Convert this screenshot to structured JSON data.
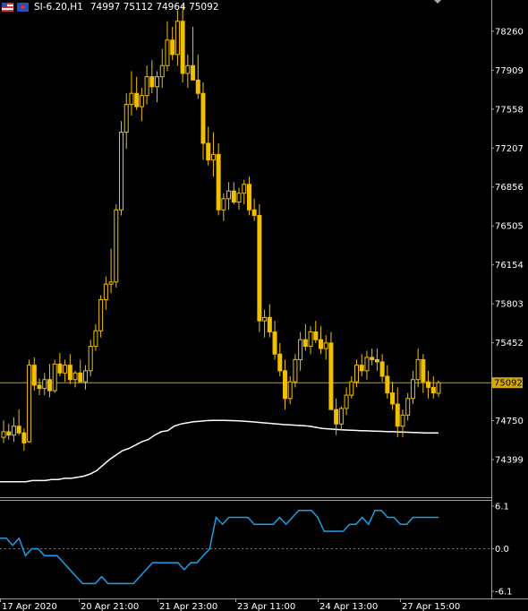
{
  "header": {
    "symbol": "SI-6.20,H1",
    "ohlc": "74997 75112 74964 75092"
  },
  "colors": {
    "background": "#000000",
    "axis": "#a0a0a0",
    "candle": "#f0c000",
    "ma": "#ffffff",
    "indicator": "#1e9fe8",
    "price_line": "#c8a200",
    "price_label_bg": "#d4a800"
  },
  "price_axis": {
    "labels": [
      "78260",
      "77909",
      "77558",
      "77207",
      "76856",
      "76505",
      "76154",
      "75803",
      "75452",
      "74750",
      "74399"
    ],
    "current_price": "75092"
  },
  "indicator_axis": {
    "labels": [
      "6.1",
      "0.0",
      "-6.1"
    ]
  },
  "time_axis": {
    "labels": [
      "17 Apr 2020",
      "20 Apr 21:00",
      "21 Apr 23:00",
      "23 Apr 11:00",
      "24 Apr 13:00",
      "27 Apr 15:00"
    ]
  },
  "chart_data": {
    "type": "candlestick",
    "symbol": "SI-6.20",
    "timeframe": "H1",
    "price_range": [
      74060,
      78380
    ],
    "indicator_range": [
      -6.1,
      6.1
    ],
    "candles": [
      [
        74600,
        74750,
        74550,
        74650
      ],
      [
        74650,
        74720,
        74580,
        74620
      ],
      [
        74620,
        74780,
        74560,
        74700
      ],
      [
        74700,
        74850,
        74620,
        74640
      ],
      [
        74640,
        74680,
        74480,
        74550
      ],
      [
        74560,
        75300,
        74550,
        75250
      ],
      [
        75250,
        75320,
        75020,
        75070
      ],
      [
        75070,
        75130,
        74980,
        75040
      ],
      [
        75040,
        75180,
        74980,
        75120
      ],
      [
        75120,
        75260,
        74960,
        75020
      ],
      [
        75020,
        75300,
        75000,
        75260
      ],
      [
        75260,
        75360,
        75150,
        75180
      ],
      [
        75180,
        75300,
        75100,
        75250
      ],
      [
        75250,
        75350,
        75080,
        75120
      ],
      [
        75120,
        75200,
        75050,
        75180
      ],
      [
        75180,
        75300,
        75100,
        75100
      ],
      [
        75100,
        75250,
        75030,
        75200
      ],
      [
        75200,
        75480,
        75150,
        75420
      ],
      [
        75420,
        75620,
        75380,
        75560
      ],
      [
        75560,
        75880,
        75500,
        75840
      ],
      [
        75840,
        76050,
        75750,
        75980
      ],
      [
        75980,
        76300,
        75900,
        76000
      ],
      [
        76000,
        76700,
        75950,
        76650
      ],
      [
        76650,
        77450,
        76600,
        77350
      ],
      [
        77350,
        77700,
        77200,
        77600
      ],
      [
        77600,
        77900,
        77500,
        77700
      ],
      [
        77700,
        77850,
        77550,
        77580
      ],
      [
        77580,
        77750,
        77450,
        77680
      ],
      [
        77680,
        77950,
        77600,
        77850
      ],
      [
        77850,
        78000,
        77700,
        77760
      ],
      [
        77760,
        77900,
        77620,
        77850
      ],
      [
        77850,
        78100,
        77750,
        77950
      ],
      [
        77950,
        78350,
        77900,
        78180
      ],
      [
        78180,
        78300,
        78000,
        78050
      ],
      [
        78050,
        78450,
        77950,
        78350
      ],
      [
        78350,
        78500,
        77800,
        77880
      ],
      [
        77880,
        78050,
        77750,
        77950
      ],
      [
        77950,
        78300,
        77850,
        77820
      ],
      [
        77820,
        78050,
        77650,
        77700
      ],
      [
        77700,
        77800,
        77100,
        77250
      ],
      [
        77250,
        77400,
        77050,
        77100
      ],
      [
        77100,
        77350,
        76950,
        77150
      ],
      [
        77150,
        77250,
        76600,
        76650
      ],
      [
        76650,
        76800,
        76550,
        76750
      ],
      [
        76750,
        76900,
        76650,
        76820
      ],
      [
        76820,
        76900,
        76700,
        76720
      ],
      [
        76720,
        76850,
        76650,
        76800
      ],
      [
        76800,
        76920,
        76700,
        76880
      ],
      [
        76880,
        76950,
        76600,
        76650
      ],
      [
        76650,
        76750,
        76550,
        76600
      ],
      [
        76600,
        76700,
        75550,
        75650
      ],
      [
        75650,
        75750,
        75500,
        75680
      ],
      [
        75680,
        75800,
        75500,
        75550
      ],
      [
        75550,
        75650,
        75300,
        75350
      ],
      [
        75350,
        75450,
        75150,
        75200
      ],
      [
        75200,
        75300,
        74850,
        74950
      ],
      [
        74950,
        75150,
        74900,
        75100
      ],
      [
        75100,
        75350,
        75050,
        75300
      ],
      [
        75300,
        75550,
        75200,
        75480
      ],
      [
        75480,
        75620,
        75380,
        75420
      ],
      [
        75420,
        75600,
        75350,
        75550
      ],
      [
        75550,
        75650,
        75450,
        75480
      ],
      [
        75480,
        75600,
        75350,
        75400
      ],
      [
        75400,
        75520,
        75300,
        75450
      ],
      [
        75450,
        75550,
        75200,
        74850
      ],
      [
        74850,
        74950,
        74620,
        74720
      ],
      [
        74720,
        74880,
        74660,
        74860
      ],
      [
        74860,
        75050,
        74800,
        74980
      ],
      [
        74980,
        75150,
        74950,
        75100
      ],
      [
        75100,
        75300,
        75050,
        75250
      ],
      [
        75250,
        75350,
        75150,
        75200
      ],
      [
        75200,
        75380,
        75120,
        75320
      ],
      [
        75320,
        75400,
        75250,
        75300
      ],
      [
        75300,
        75400,
        75200,
        75280
      ],
      [
        75280,
        75350,
        75100,
        75150
      ],
      [
        75150,
        75250,
        74950,
        75000
      ],
      [
        75000,
        75100,
        74850,
        74900
      ],
      [
        74900,
        75050,
        74600,
        74700
      ],
      [
        74700,
        74850,
        74600,
        74800
      ],
      [
        74800,
        75000,
        74750,
        74950
      ],
      [
        74950,
        75200,
        74900,
        75120
      ],
      [
        75120,
        75400,
        75050,
        75300
      ],
      [
        75300,
        75350,
        75000,
        75100
      ],
      [
        75100,
        75200,
        74950,
        75050
      ],
      [
        75050,
        75150,
        74950,
        75000
      ],
      [
        74997,
        75112,
        74964,
        75092
      ]
    ],
    "ma": [
      74200,
      74200,
      74200,
      74200,
      74200,
      74210,
      74210,
      74210,
      74220,
      74220,
      74230,
      74230,
      74240,
      74250,
      74270,
      74300,
      74350,
      74400,
      74440,
      74480,
      74500,
      74530,
      74560,
      74580,
      74620,
      74650,
      74660,
      74700,
      74720,
      74730,
      74740,
      74745,
      74750,
      74752,
      74752,
      74752,
      74750,
      74748,
      74745,
      74740,
      74735,
      74730,
      74725,
      74720,
      74715,
      74712,
      74708,
      74705,
      74700,
      74690,
      74680,
      74675,
      74672,
      74668,
      74665,
      74662,
      74660,
      74658,
      74656,
      74654,
      74652,
      74650,
      74648,
      74646,
      74644,
      74642,
      74640,
      74640,
      74640
    ],
    "indicator": [
      1.5,
      1.5,
      0.5,
      1.5,
      -1.0,
      0.0,
      0.0,
      -1.0,
      -1.0,
      -1.0,
      -2.0,
      -3.0,
      -4.0,
      -5.0,
      -5.0,
      -5.0,
      -4.0,
      -5.0,
      -5.0,
      -5.0,
      -5.0,
      -5.0,
      -4.0,
      -3.0,
      -2.0,
      -2.0,
      -2.0,
      -2.0,
      -2.0,
      -3.0,
      -2.0,
      -2.0,
      -1.0,
      0.0,
      4.5,
      3.5,
      4.5,
      4.5,
      4.5,
      4.5,
      3.5,
      3.5,
      3.5,
      3.5,
      4.5,
      3.5,
      4.5,
      5.5,
      5.5,
      5.5,
      4.5,
      2.5,
      2.5,
      2.5,
      2.5,
      3.5,
      3.5,
      4.5,
      3.5,
      5.5,
      5.5,
      4.5,
      4.5,
      3.5,
      3.5,
      4.5,
      4.5,
      4.5,
      4.5,
      4.5
    ]
  }
}
